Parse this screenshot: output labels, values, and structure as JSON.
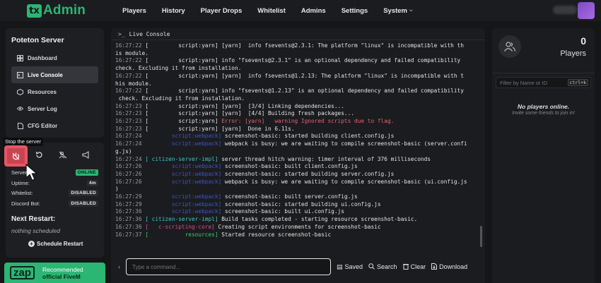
{
  "app": {
    "logo_tx": "tx",
    "logo_text": "Admin"
  },
  "nav": [
    "Players",
    "History",
    "Player Drops",
    "Whitelist",
    "Admins",
    "Settings",
    "System"
  ],
  "sidebar": {
    "title": "Poteton Server",
    "items": [
      {
        "label": "Dashboard",
        "icon": "dashboard-icon"
      },
      {
        "label": "Live Console",
        "icon": "terminal-icon"
      },
      {
        "label": "Resources",
        "icon": "box-icon"
      },
      {
        "label": "Server Log",
        "icon": "eye-icon"
      },
      {
        "label": "CFG Editor",
        "icon": "file-icon"
      }
    ]
  },
  "tooltip": "Stop the server",
  "status": {
    "server_label": "Server:",
    "server_value": "ONLINE",
    "uptime_label": "Uptime:",
    "uptime_value": "4m",
    "whitelist_label": "Whitelist:",
    "whitelist_value": "DISABLED",
    "discord_label": "Discord Bot:",
    "discord_value": "DISABLED"
  },
  "restart": {
    "title": "Next Restart:",
    "value": "nothing scheduled",
    "button": "Schedule Restart"
  },
  "promo": {
    "logo": "zap",
    "line1": "Recommended",
    "line2": "official FiveM"
  },
  "console": {
    "title": "Live Console",
    "input_placeholder": "Type a command...",
    "buttons": {
      "saved": "Saved",
      "search": "Search",
      "clear": "Clear",
      "download": "Download"
    },
    "lines": [
      {
        "ts": "16:27:22",
        "tag": "[         script:yarn]",
        "tc": "",
        "msg": " [yarn]  info fsevents@2.3.1: The platform \"linux\" is incompatible with th",
        "mc": ""
      },
      {
        "ts": "",
        "tag": "",
        "tc": "",
        "msg": "is module.",
        "mc": ""
      },
      {
        "ts": "16:27:22",
        "tag": "[         script:yarn]",
        "tc": "",
        "msg": " info \"fsevents@2.3.1\" is an optional dependency and failed compatibility",
        "mc": ""
      },
      {
        "ts": "",
        "tag": "",
        "tc": "",
        "msg": "check. Excluding it from installation.",
        "mc": ""
      },
      {
        "ts": "16:27:22",
        "tag": "[         script:yarn]",
        "tc": "",
        "msg": " [yarn]  info fsevents@1.2.13: The platform \"linux\" is incompatible with t",
        "mc": ""
      },
      {
        "ts": "",
        "tag": "",
        "tc": "",
        "msg": "his module.",
        "mc": ""
      },
      {
        "ts": "16:27:22",
        "tag": "[         script:yarn]",
        "tc": "",
        "msg": " info \"fsevents@1.2.13\" is an optional dependency and failed compatibility",
        "mc": ""
      },
      {
        "ts": "",
        "tag": "",
        "tc": "",
        "msg": " check. Excluding it from installation.",
        "mc": ""
      },
      {
        "ts": "16:27:23",
        "tag": "[         script:yarn]",
        "tc": "",
        "msg": " [yarn]  [3/4] Linking dependencies...",
        "mc": ""
      },
      {
        "ts": "16:27:23",
        "tag": "[         script:yarn]",
        "tc": "",
        "msg": " [yarn]  [4/4] Building fresh packages...",
        "mc": ""
      },
      {
        "ts": "16:27:23",
        "tag": "[         script:yarn]",
        "tc": "",
        "msg": " Error: [yarn]   warning Ignored scripts due to flag.",
        "mc": "err"
      },
      {
        "ts": "16:27:23",
        "tag": "[         script:yarn]",
        "tc": "",
        "msg": " [yarn]  Done in 6.11s.",
        "mc": ""
      },
      {
        "ts": "16:27:24",
        "tag": "        script:webpack]",
        "tc": "blue",
        "msg": " screenshot-basic: started building client.config.js",
        "mc": ""
      },
      {
        "ts": "16:27:24",
        "tag": "        script:webpack]",
        "tc": "blue",
        "msg": " webpack is busy: we are waiting to compile screenshot-basic (server.confi",
        "mc": ""
      },
      {
        "ts": "",
        "tag": "",
        "tc": "",
        "msg": "g.js)",
        "mc": ""
      },
      {
        "ts": "16:27:24",
        "tag": "[ citizen-server-impl]",
        "tc": "cyan",
        "msg": " server thread hitch warning: timer interval of 376 milliseconds",
        "mc": ""
      },
      {
        "ts": "16:27:26",
        "tag": "        script:webpack]",
        "tc": "blue",
        "msg": " screenshot-basic: built client.config.js",
        "mc": ""
      },
      {
        "ts": "16:27:26",
        "tag": "        script:webpack]",
        "tc": "blue",
        "msg": " screenshot-basic: started building server.config.js",
        "mc": ""
      },
      {
        "ts": "16:27:26",
        "tag": "        script:webpack]",
        "tc": "blue",
        "msg": " webpack is busy: we are waiting to compile screenshot-basic (ui.config.js",
        "mc": ""
      },
      {
        "ts": "",
        "tag": "",
        "tc": "",
        "msg": ")",
        "mc": ""
      },
      {
        "ts": "16:27:29",
        "tag": "        script:webpack]",
        "tc": "blue",
        "msg": " screenshot-basic: built server.config.js",
        "mc": ""
      },
      {
        "ts": "16:27:29",
        "tag": "        script:webpack]",
        "tc": "blue",
        "msg": " screenshot-basic: started building ui.config.js",
        "mc": ""
      },
      {
        "ts": "16:27:36",
        "tag": "        script:webpack]",
        "tc": "blue",
        "msg": " screenshot-basic: built ui.config.js",
        "mc": ""
      },
      {
        "ts": "16:27:36",
        "tag": "[ citizen-server-impl]",
        "tc": "cyan",
        "msg": " Build tasks completed - starting resource screenshot-basic.",
        "mc": ""
      },
      {
        "ts": "16:27:36",
        "tag": "[   c-scripting-core]",
        "tc": "pink",
        "msg": " Creating script environments for screenshot-basic",
        "mc": ""
      },
      {
        "ts": "16:27:37",
        "tag": "[           resources]",
        "tc": "green",
        "msg": " Started resource screenshot-basic",
        "mc": ""
      }
    ]
  },
  "players": {
    "count": "0",
    "label": "Players",
    "search_placeholder": "Filter by Name or ID",
    "shortcut": "ctrl+k",
    "empty_title": "No players online.",
    "empty_sub": "Invite some friends to join in!"
  }
}
